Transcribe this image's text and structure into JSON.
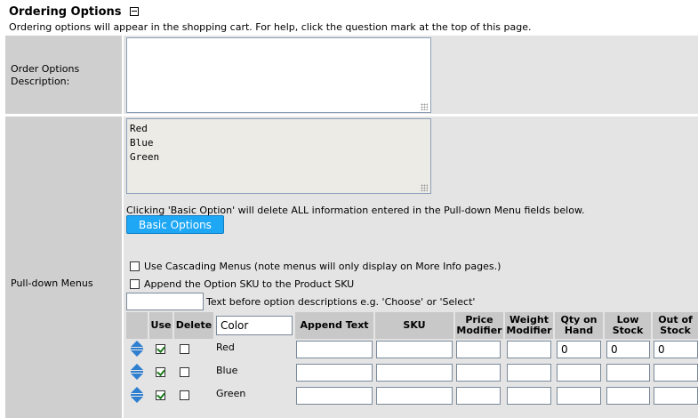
{
  "section": {
    "title": "Ordering Options",
    "subtitle": "Ordering options will appear in the shopping cart. For help, click the question mark at the top of this page."
  },
  "order_options": {
    "label_line1": "Order Options",
    "label_line2": "Description:",
    "value": ""
  },
  "pulldown": {
    "label": "Pull-down Menus",
    "values": "Red\nBlue\nGreen",
    "warning": "Clicking 'Basic Option' will delete ALL information entered in the Pull-down Menu fields below.",
    "basic_button": "Basic Options",
    "cascading_label": "Use Cascading Menus (note menus will only display on More Info pages.)",
    "append_sku_label": "Append the Option SKU to the Product SKU",
    "text_before_label": "Text before option descriptions e.g. 'Choose' or 'Select'",
    "text_before_value": "",
    "menu_name_value": "Color"
  },
  "table": {
    "headers": {
      "use": "Use",
      "delete": "Delete",
      "append_text": "Append Text",
      "sku": "SKU",
      "price_modifier": "Price Modifier",
      "weight_modifier": "Weight Modifier",
      "qty_on_hand": "Qty on Hand",
      "low_stock": "Low Stock",
      "out_of_stock": "Out of Stock"
    },
    "rows": [
      {
        "name": "Red",
        "use": true,
        "delete": false,
        "qty": "0",
        "low": "0",
        "out": "0"
      },
      {
        "name": "Blue",
        "use": true,
        "delete": false,
        "qty": "",
        "low": "",
        "out": ""
      },
      {
        "name": "Green",
        "use": true,
        "delete": false,
        "qty": "",
        "low": "",
        "out": ""
      }
    ]
  },
  "colors": {
    "button_bg": "#1ea7f5",
    "label_bg": "#cfcfcf",
    "body_bg": "#e4e4e4",
    "header_bg": "#c8c8c8",
    "arrow": "#2f7fd1"
  }
}
